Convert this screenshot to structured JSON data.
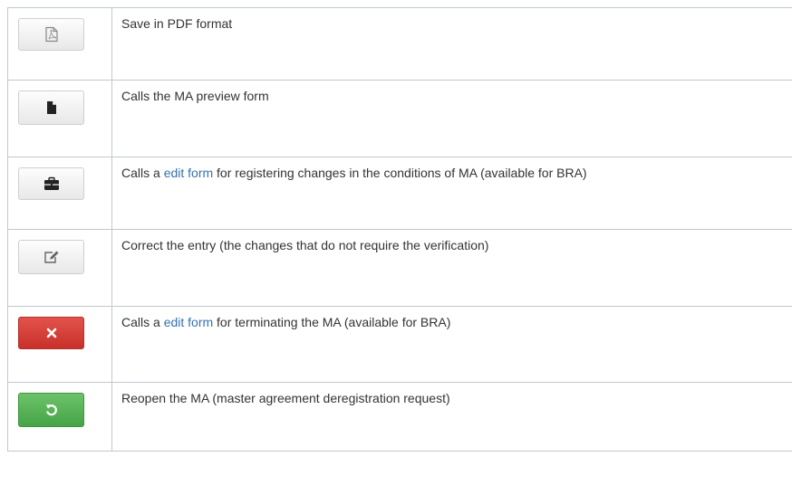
{
  "rows": [
    {
      "icon": "pdf-icon",
      "description": "Save in PDF format"
    },
    {
      "icon": "document-icon",
      "description": "Calls the MA preview form"
    },
    {
      "icon": "briefcase-icon",
      "description_before": "Calls a ",
      "link_text": "edit form",
      "description_after": " for registering changes in the conditions of MA (available for BRA)"
    },
    {
      "icon": "edit-icon",
      "description": "Correct the entry (the changes that do not require the verification)"
    },
    {
      "icon": "close-icon",
      "description_before": "Calls a ",
      "link_text": "edit form",
      "description_after": " for terminating the MA (available for BRA)"
    },
    {
      "icon": "undo-icon",
      "description": "Reopen the MA (master agreement deregistration request)"
    }
  ],
  "colors": {
    "link": "#3572b0",
    "danger_button": "#d9534f",
    "success_button": "#5cb85c",
    "table_border": "#c1c7d0",
    "text": "#333333"
  }
}
